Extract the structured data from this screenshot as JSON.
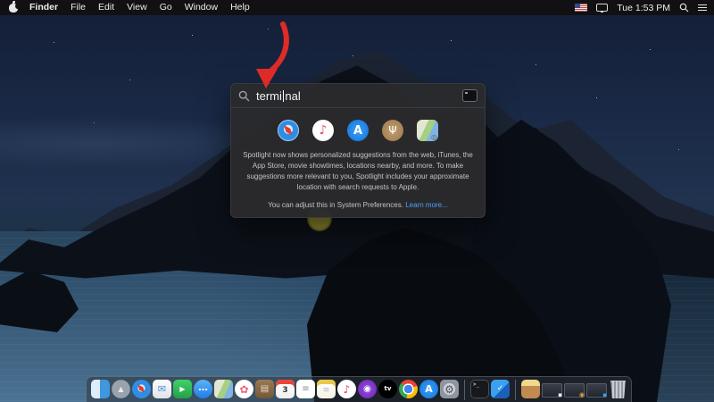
{
  "menu_bar": {
    "items": [
      {
        "id": "finder",
        "label": "Finder"
      },
      {
        "id": "file",
        "label": "File"
      },
      {
        "id": "edit",
        "label": "Edit"
      },
      {
        "id": "view",
        "label": "View"
      },
      {
        "id": "go",
        "label": "Go"
      },
      {
        "id": "window",
        "label": "Window"
      },
      {
        "id": "help",
        "label": "Help"
      }
    ],
    "status": {
      "clock": "Tue 1:53 PM"
    }
  },
  "spotlight": {
    "query_before_cursor": "termi",
    "query_after_cursor": "nal",
    "suggestion_icons": [
      {
        "id": "safari",
        "glyph": "◆"
      },
      {
        "id": "music",
        "glyph": "♪"
      },
      {
        "id": "appstore",
        "glyph": "A"
      },
      {
        "id": "food",
        "glyph": "Ψ"
      },
      {
        "id": "maps",
        "glyph": "◎"
      }
    ],
    "description": "Spotlight now shows personalized suggestions from the web, iTunes, the App Store, movie showtimes, locations nearby, and more. To make suggestions more relevant to you, Spotlight includes your approximate location with search requests to Apple.",
    "footer_text": "You can adjust this in System Preferences.",
    "footer_link": "Learn more..."
  },
  "dock": {
    "items": [
      {
        "id": "finder",
        "glyph": ""
      },
      {
        "id": "launchpad",
        "glyph": "▲"
      },
      {
        "id": "safari",
        "glyph": "◆"
      },
      {
        "id": "mail",
        "glyph": "✉"
      },
      {
        "id": "facetime",
        "glyph": "▶"
      },
      {
        "id": "messages",
        "glyph": "…"
      },
      {
        "id": "maps",
        "glyph": ""
      },
      {
        "id": "photos",
        "glyph": "✿"
      },
      {
        "id": "contacts",
        "glyph": "▤"
      },
      {
        "id": "calendar",
        "glyph": "3"
      },
      {
        "id": "reminders",
        "glyph": "≡"
      },
      {
        "id": "notes",
        "glyph": "≡"
      },
      {
        "id": "music",
        "glyph": "♪"
      },
      {
        "id": "podcasts",
        "glyph": "◉"
      },
      {
        "id": "appletv",
        "glyph": "tv"
      },
      {
        "id": "chrome",
        "glyph": ""
      },
      {
        "id": "appstore",
        "glyph": "A"
      },
      {
        "id": "sysprefs",
        "glyph": "⚙"
      },
      {
        "id": "sep1",
        "glyph": ""
      },
      {
        "id": "terminal",
        "glyph": ">_"
      },
      {
        "id": "vscode",
        "glyph": "✓"
      },
      {
        "id": "sep2",
        "glyph": ""
      },
      {
        "id": "installer",
        "glyph": ""
      },
      {
        "id": "win-doc",
        "glyph": "▪"
      },
      {
        "id": "win-chrome",
        "glyph": "◉"
      },
      {
        "id": "win-code",
        "glyph": "▪"
      },
      {
        "id": "trash",
        "glyph": ""
      }
    ]
  },
  "colors": {
    "accent_link": "#4da2ff",
    "arrow_red": "#df2b28"
  }
}
